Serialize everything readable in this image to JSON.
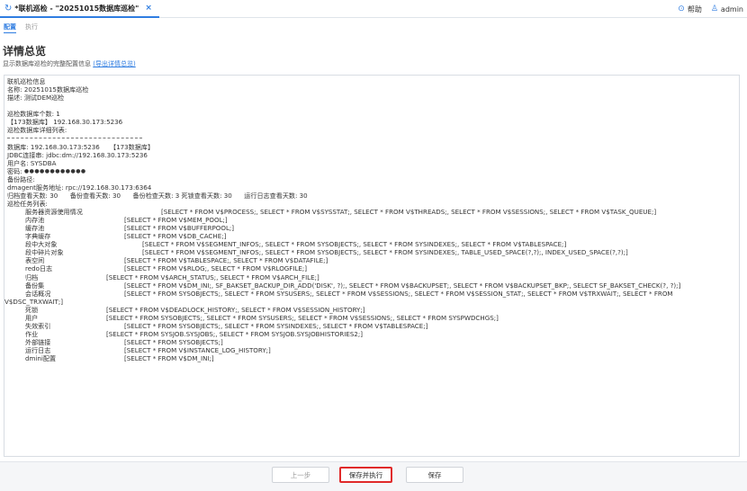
{
  "tab": {
    "title": "*联机巡检 - \"20251015数据库巡检\"",
    "close_symbol": "×"
  },
  "header": {
    "help_label": "帮助",
    "user_label": "admin"
  },
  "subtabs": {
    "config": "配置",
    "execute": "执行"
  },
  "page": {
    "title": "详情总览",
    "description": "显示数据库巡检的完整配置信息",
    "export_link": "(导出详情总览)"
  },
  "details": {
    "section_header": "联机巡检信息",
    "name_line": "名称: 20251015数据库巡检",
    "desc_line": "描述: 测试DEM巡检",
    "db_count_line": "巡检数据库个数: 1",
    "db_entry_line": "【173数据库】 192.168.30.173:5236",
    "db_list_label": "巡检数据库详细列表:",
    "db_line": "数据库: 192.168.30.173:5236     【173数据库】",
    "jdbc_line": "JDBC连接串: jdbc:dm://192.168.30.173:5236",
    "user_line": "用户名: SYSDBA",
    "password_label": "密码: ",
    "password_mask": "●●●●●●●●●●●●",
    "backup_path_line": "备份路径:",
    "dmagent_line": "dmagent服务地址: rpc://192.168.30.173:6364",
    "days_line": "归档查看天数: 30      备份查看天数: 30      备份检查天数: 3 死锁查看天数: 30      运行日志查看天数: 30",
    "task_list_label": "巡检任务列表:"
  },
  "tasks": [
    {
      "name": "服务器资源使用情况",
      "sql": "[SELECT * FROM V$PROCESS;, SELECT * FROM V$SYSSTAT;, SELECT * FROM V$THREADS;, SELECT * FROM V$SESSIONS;, SELECT * FROM V$TASK_QUEUE;]",
      "indent": 171
    },
    {
      "name": "内存池",
      "sql": "[SELECT * FROM V$MEM_POOL;]",
      "indent": 130
    },
    {
      "name": "缓存池",
      "sql": "[SELECT * FROM V$BUFFERPOOL;]",
      "indent": 130
    },
    {
      "name": "字典缓存",
      "sql": "[SELECT * FROM V$DB_CACHE;]",
      "indent": 130
    },
    {
      "name": "段中大对象",
      "sql": "[SELECT * FROM V$SEGMENT_INFOS;, SELECT * FROM SYSOBJECTS;, SELECT * FROM SYSINDEXES;, SELECT * FROM V$TABLESPACE;]",
      "indent": 150
    },
    {
      "name": "段中碎片对象",
      "sql": "[SELECT * FROM V$SEGMENT_INFOS;, SELECT * FROM SYSOBJECTS;, SELECT * FROM SYSINDEXES;, TABLE_USED_SPACE(?,?);, INDEX_USED_SPACE(?,?);]",
      "indent": 150
    },
    {
      "name": "表空间",
      "sql": "[SELECT * FROM V$TABLESPACE;, SELECT * FROM V$DATAFILE;]",
      "indent": 130
    },
    {
      "name": "redo日志",
      "sql": "[SELECT * FROM V$RLOG;, SELECT * FROM V$RLOGFILE;]",
      "indent": 130
    },
    {
      "name": "归档",
      "sql": "[SELECT * FROM V$ARCH_STATUS;, SELECT * FROM V$ARCH_FILE;]",
      "indent": 110
    },
    {
      "name": "备份集",
      "sql": "[SELECT * FROM V$DM_INI;, SF_BAKSET_BACKUP_DIR_ADD('DISK', ?);, SELECT * FROM V$BACKUPSET;, SELECT * FROM V$BACKUPSET_BKP;, SELECT SF_BAKSET_CHECK(?, ?);]",
      "indent": 130
    },
    {
      "name": "会话概况",
      "sql": "[SELECT * FROM SYSOBJECTS;, SELECT * FROM SYSUSERS;, SELECT * FROM V$SESSIONS;, SELECT * FROM V$SESSION_STAT;, SELECT * FROM V$TRXWAIT;, SELECT * FROM",
      "sql_tail": "V$DSC_TRXWAIT;]",
      "indent": 130
    },
    {
      "name": "死锁",
      "sql": "[SELECT * FROM V$DEADLOCK_HISTORY;, SELECT * FROM V$SESSION_HISTORY;]",
      "indent": 110
    },
    {
      "name": "用户",
      "sql": "[SELECT * FROM SYSOBJECTS;, SELECT * FROM SYSUSERS;, SELECT * FROM V$SESSIONS;, SELECT * FROM SYSPWDCHGS;]",
      "indent": 110
    },
    {
      "name": "失效索引",
      "sql": "[SELECT * FROM SYSOBJECTS;, SELECT * FROM SYSINDEXES;, SELECT * FROM V$TABLESPACE;]",
      "indent": 130
    },
    {
      "name": "作业",
      "sql": "[SELECT * FROM SYSJOB.SYSJOBS;, SELECT * FROM SYSJOB.SYSJOBHISTORIES2;]",
      "indent": 110
    },
    {
      "name": "外部链接",
      "sql": "[SELECT * FROM SYSOBJECTS;]",
      "indent": 130
    },
    {
      "name": "运行日志",
      "sql": "[SELECT * FROM V$INSTANCE_LOG_HISTORY;]",
      "indent": 130
    },
    {
      "name": "dmini配置",
      "sql": "[SELECT * FROM V$DM_INI;]",
      "indent": 130
    }
  ],
  "footer": {
    "prev_label": "上一步",
    "save_run_label": "保存并执行",
    "save_label": "保存"
  },
  "colors": {
    "accent": "#2f7de1",
    "highlight_border": "#e02a2a"
  }
}
